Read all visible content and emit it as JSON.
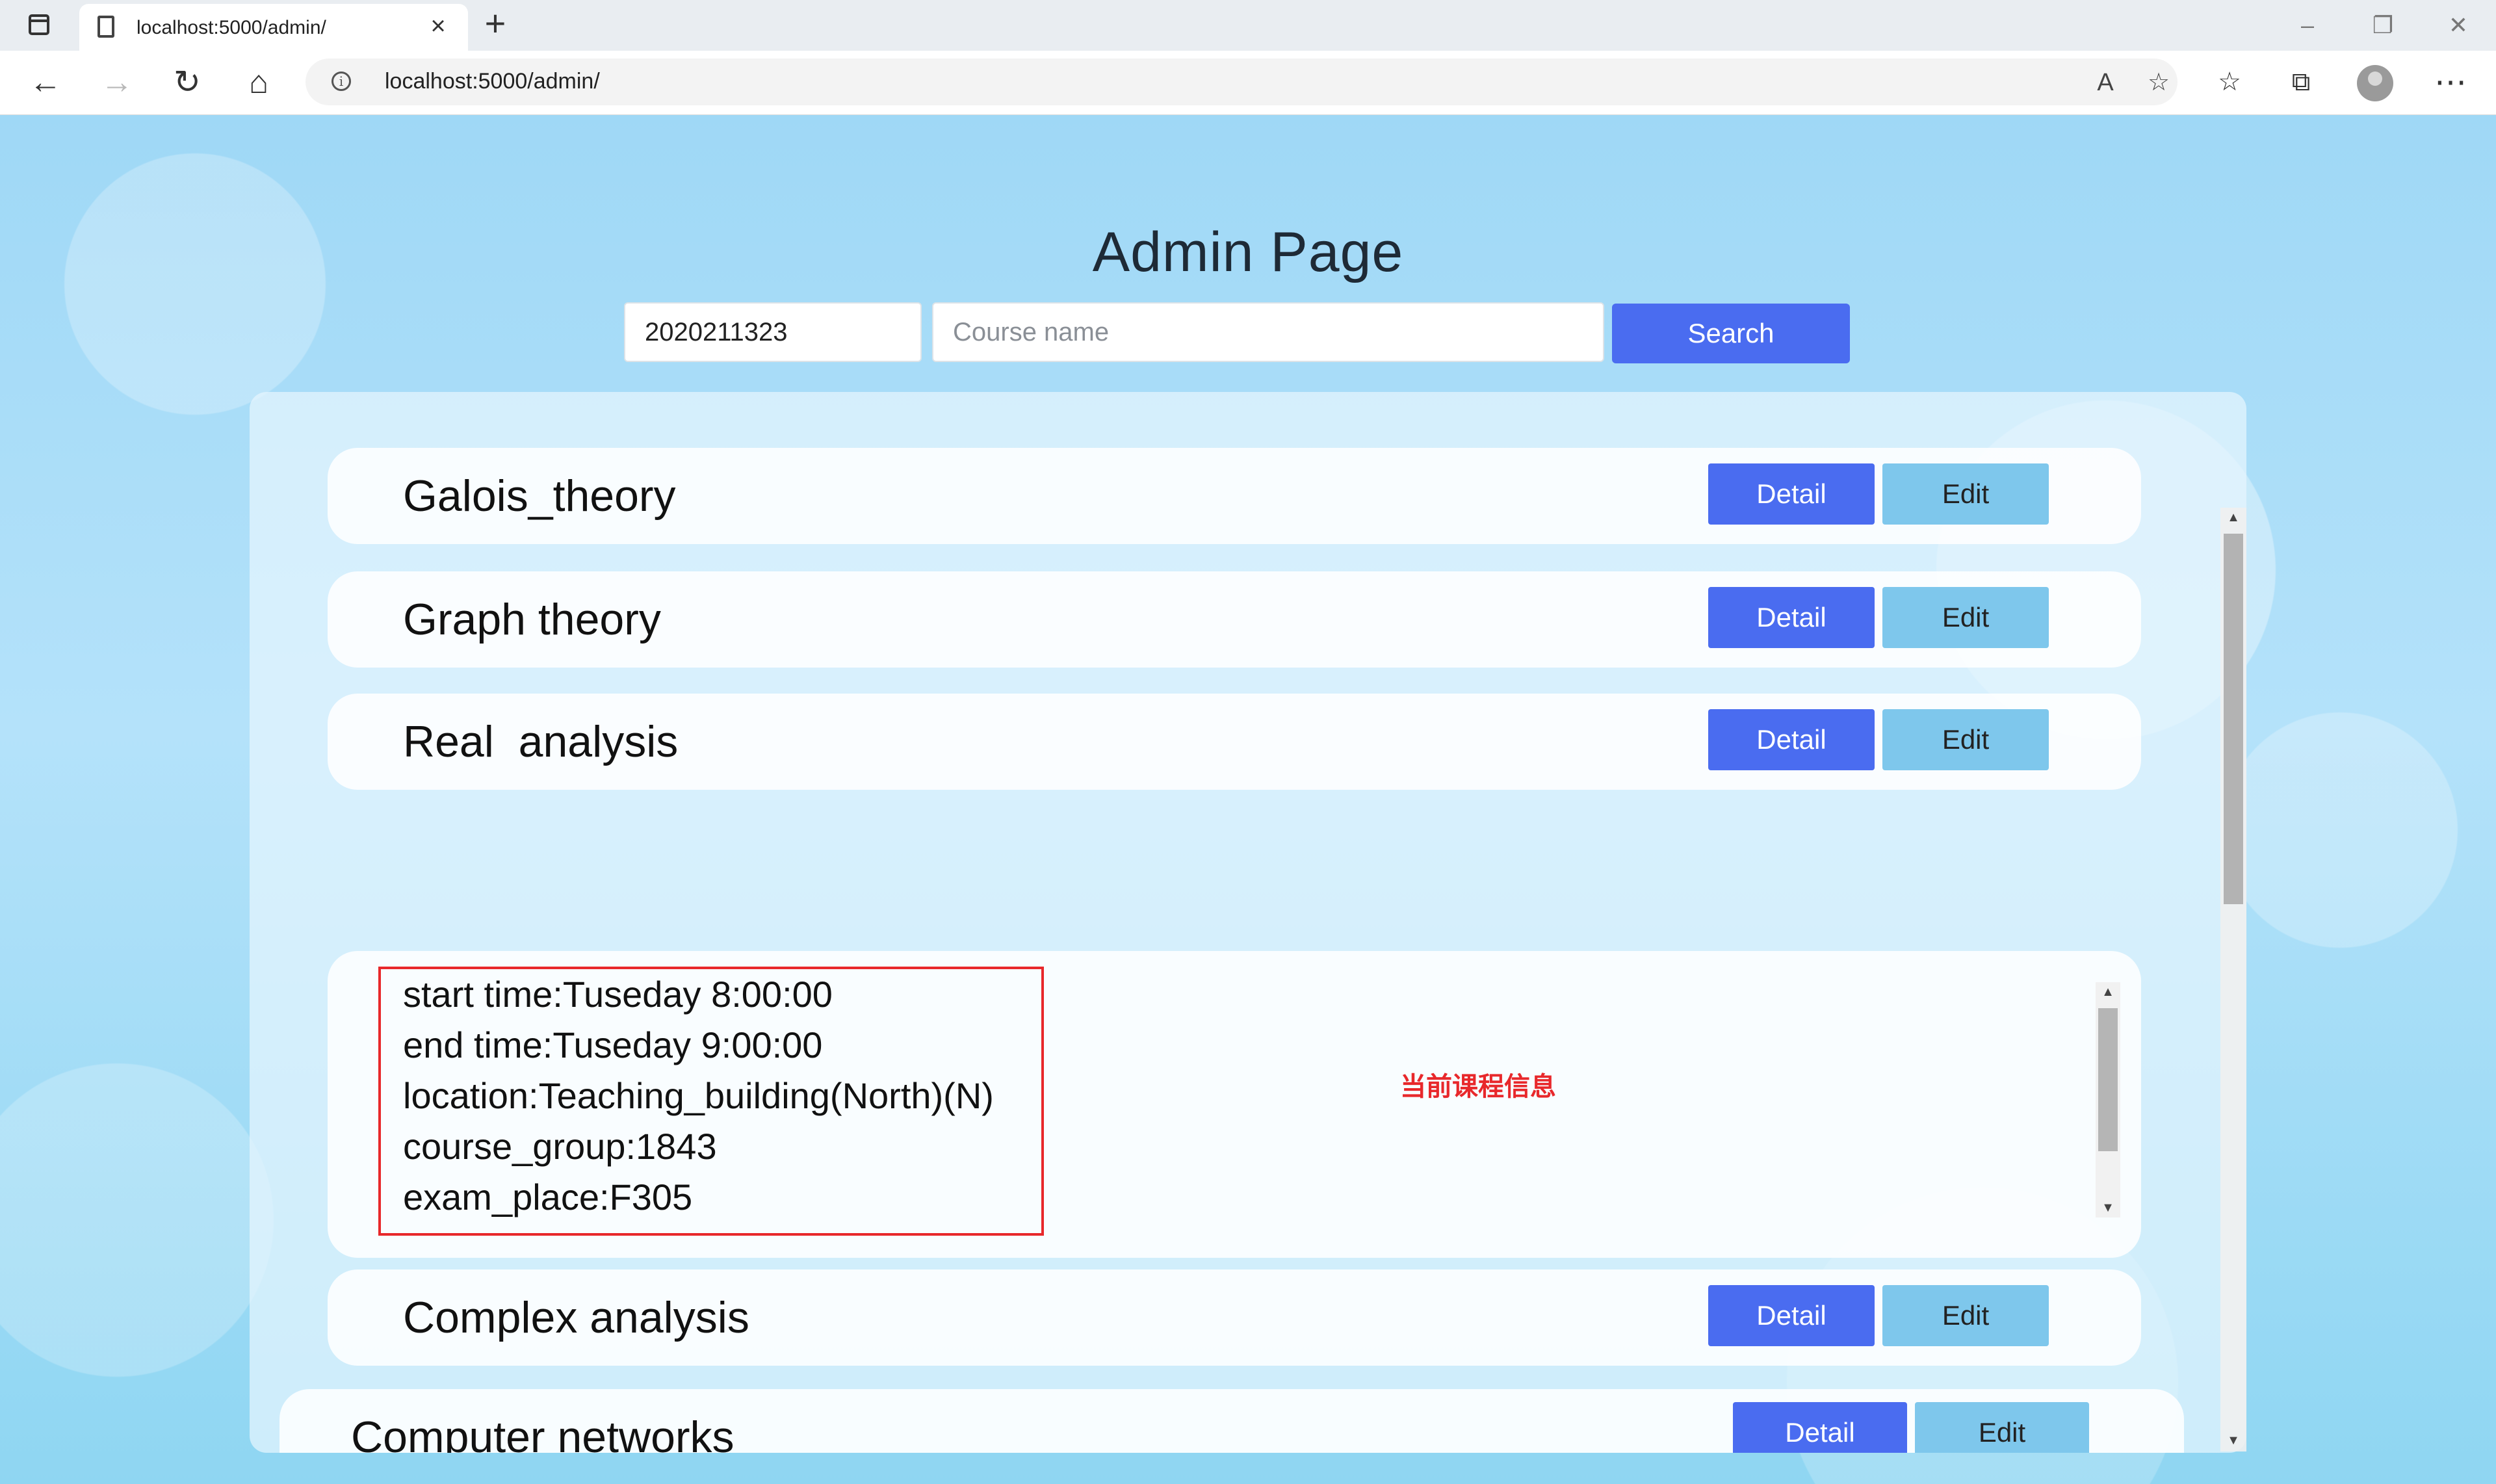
{
  "browser": {
    "tab_title": "localhost:5000/admin/",
    "url": "localhost:5000/admin/",
    "tab_close_glyph": "×",
    "new_tab_glyph": "+"
  },
  "page": {
    "title": "Admin Page",
    "student_id_value": "2020211323",
    "course_placeholder": "Course name",
    "search_label": "Search"
  },
  "courses": [
    {
      "name": "Galois_theory",
      "detail_label": "Detail",
      "edit_label": "Edit"
    },
    {
      "name": "Graph theory",
      "detail_label": "Detail",
      "edit_label": "Edit"
    },
    {
      "name": "Real  analysis",
      "detail_label": "Detail",
      "edit_label": "Edit"
    },
    {
      "name": "Complex analysis",
      "detail_label": "Detail",
      "edit_label": "Edit"
    },
    {
      "name": "Computer networks",
      "detail_label": "Detail",
      "edit_label": "Edit"
    }
  ],
  "detail": {
    "lines": [
      "start time:Tuseday 8:00:00",
      "end time:Tuseday 9:00:00",
      "location:Teaching_building(North)(N)",
      "course_group:1843",
      "exam_place:F305"
    ],
    "annotation": "当前课程信息"
  },
  "colors": {
    "primary_button": "#4a6cf0",
    "edit_button": "#7ec7ec",
    "annotation_red": "#e8282b"
  },
  "icons": [
    "sidebar-toggle-icon",
    "page-icon",
    "back-icon",
    "forward-icon",
    "reload-icon",
    "home-icon",
    "info-icon",
    "read-aloud-icon",
    "add-favorite-icon",
    "favorites-icon",
    "collections-icon",
    "profile-icon",
    "more-icon"
  ]
}
